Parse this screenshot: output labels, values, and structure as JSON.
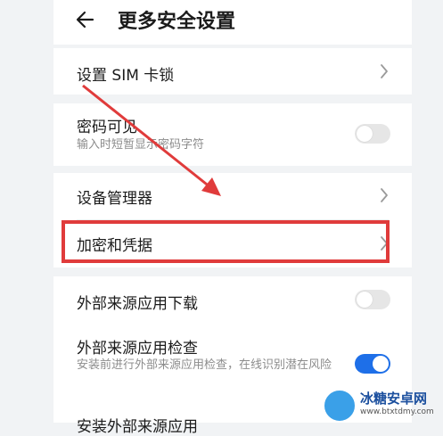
{
  "header": {
    "title": "更多安全设置"
  },
  "rows": {
    "sim_lock": {
      "label": "设置 SIM 卡锁"
    },
    "password_visible": {
      "label": "密码可见",
      "subtitle": "输入时短暂显示密码字符",
      "toggle": "off"
    },
    "device_manager": {
      "label": "设备管理器"
    },
    "encryption": {
      "label": "加密和凭据"
    },
    "external_download": {
      "label": "外部来源应用下载",
      "toggle": "off"
    },
    "external_check": {
      "label": "外部来源应用检查",
      "subtitle": "安装前进行外部来源应用检查，在线识别潜在风险",
      "toggle": "on"
    },
    "partial_next": {
      "label": "安装外部来源应用"
    }
  },
  "annotation": {
    "highlight_color": "#e03b3b"
  },
  "watermark": {
    "name": "冰糖安卓网",
    "url": "www.btxtdmy.com"
  },
  "colors": {
    "toggle_on": "#1e6fe8",
    "background": "#f1f3f5"
  }
}
